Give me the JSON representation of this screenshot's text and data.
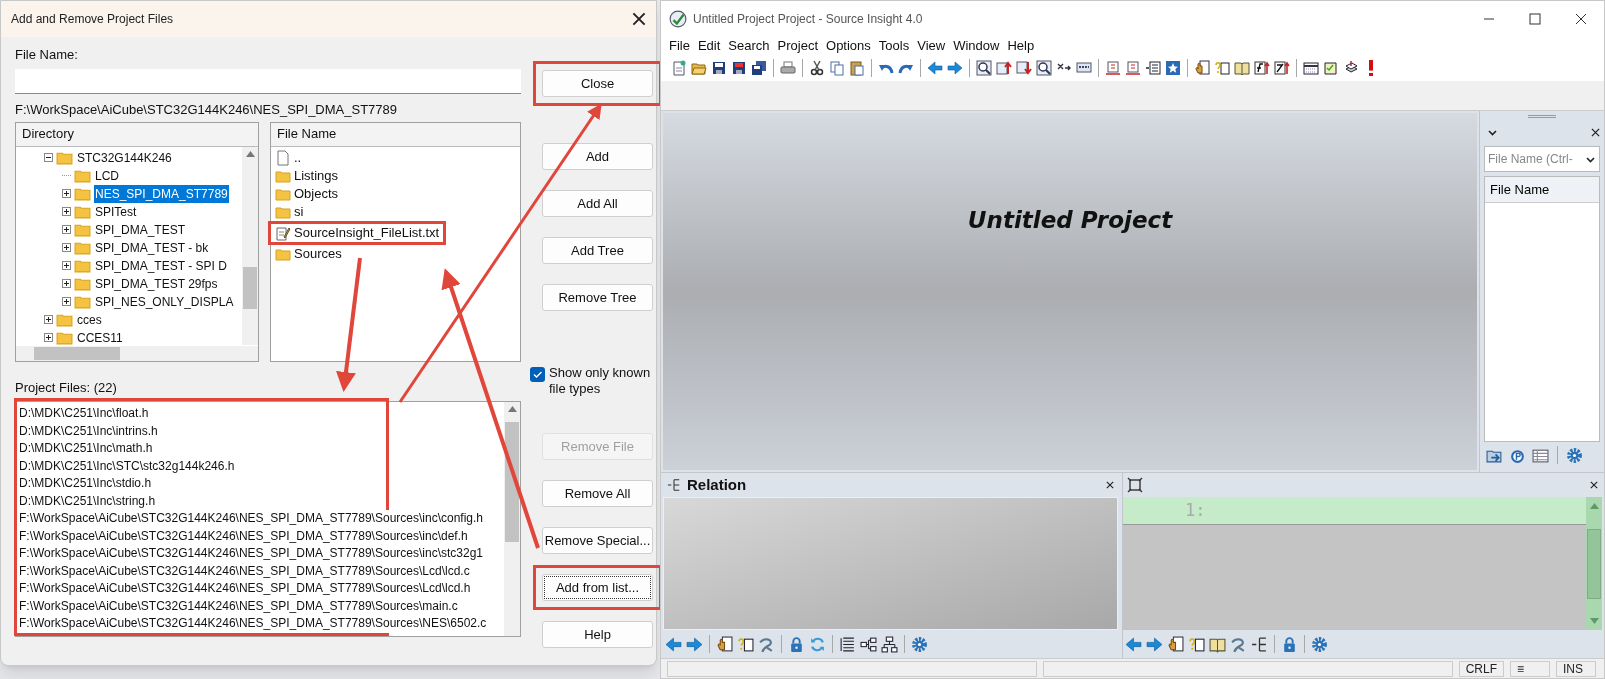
{
  "dialog": {
    "title": "Add and Remove Project Files",
    "file_name_label": "File Name:",
    "path": "F:\\WorkSpace\\AiCube\\STC32G144K246\\NES_SPI_DMA_ST7789",
    "directory": {
      "header": "Directory",
      "items": [
        {
          "label": "STC32G144K246",
          "expanded": true,
          "selected": false,
          "children": [
            {
              "label": "LCD",
              "selected": false
            },
            {
              "label": "NES_SPI_DMA_ST7789",
              "expanded": false,
              "selected": true
            },
            {
              "label": "SPITest",
              "expanded": false,
              "selected": false
            },
            {
              "label": "SPI_DMA_TEST",
              "expanded": false,
              "selected": false
            },
            {
              "label": "SPI_DMA_TEST - bk",
              "expanded": false,
              "selected": false
            },
            {
              "label": "SPI_DMA_TEST - SPI D",
              "expanded": false,
              "selected": false
            },
            {
              "label": "SPI_DMA_TEST 29fps",
              "expanded": false,
              "selected": false
            },
            {
              "label": "SPI_NES_ONLY_DISPLA",
              "expanded": false,
              "selected": false
            }
          ]
        },
        {
          "label": "cces",
          "expanded": false,
          "selected": false
        },
        {
          "label": "CCES11",
          "expanded": false,
          "selected": false
        }
      ]
    },
    "files": {
      "header": "File Name",
      "items": [
        {
          "label": "..",
          "kind": "page",
          "highlighted": false
        },
        {
          "label": "Listings",
          "kind": "folder",
          "highlighted": false
        },
        {
          "label": "Objects",
          "kind": "folder",
          "highlighted": false
        },
        {
          "label": "si",
          "kind": "folder",
          "highlighted": false
        },
        {
          "label": "SourceInsight_FileList.txt",
          "kind": "note",
          "highlighted": true
        },
        {
          "label": "Sources",
          "kind": "folder",
          "highlighted": false
        }
      ]
    },
    "top_buttons": [
      {
        "label": "Close",
        "disabled": false,
        "focused": false,
        "highlighted": true
      },
      {
        "label": "Add",
        "disabled": false,
        "focused": false,
        "highlighted": false
      },
      {
        "label": "Add All",
        "disabled": false,
        "focused": false,
        "highlighted": false
      },
      {
        "label": "Add Tree",
        "disabled": false,
        "focused": false,
        "highlighted": false
      },
      {
        "label": "Remove Tree",
        "disabled": false,
        "focused": false,
        "highlighted": false
      }
    ],
    "checkbox": {
      "label": "Show only known file types",
      "checked": true
    },
    "project_files_label": "Project Files: (22)",
    "project_files": [
      "D:\\MDK\\C251\\Inc\\float.h",
      "D:\\MDK\\C251\\Inc\\intrins.h",
      "D:\\MDK\\C251\\Inc\\math.h",
      "D:\\MDK\\C251\\Inc\\STC\\stc32g144k246.h",
      "D:\\MDK\\C251\\Inc\\stdio.h",
      "D:\\MDK\\C251\\Inc\\string.h",
      "F:\\WorkSpace\\AiCube\\STC32G144K246\\NES_SPI_DMA_ST7789\\Sources\\inc\\config.h",
      "F:\\WorkSpace\\AiCube\\STC32G144K246\\NES_SPI_DMA_ST7789\\Sources\\inc\\def.h",
      "F:\\WorkSpace\\AiCube\\STC32G144K246\\NES_SPI_DMA_ST7789\\Sources\\inc\\stc32g1",
      "F:\\WorkSpace\\AiCube\\STC32G144K246\\NES_SPI_DMA_ST7789\\Sources\\Lcd\\lcd.c",
      "F:\\WorkSpace\\AiCube\\STC32G144K246\\NES_SPI_DMA_ST7789\\Sources\\Lcd\\lcd.h",
      "F:\\WorkSpace\\AiCube\\STC32G144K246\\NES_SPI_DMA_ST7789\\Sources\\main.c",
      "F:\\WorkSpace\\AiCube\\STC32G144K246\\NES_SPI_DMA_ST7789\\Sources\\NES\\6502.c"
    ],
    "bottom_buttons": [
      {
        "label": "Remove File",
        "disabled": true,
        "focused": false,
        "highlighted": false
      },
      {
        "label": "Remove All",
        "disabled": false,
        "focused": false,
        "highlighted": false
      },
      {
        "label": "Remove Special...",
        "disabled": false,
        "focused": false,
        "highlighted": false
      },
      {
        "label": "Add from list...",
        "disabled": false,
        "focused": true,
        "highlighted": true
      },
      {
        "label": "Help",
        "disabled": false,
        "focused": false,
        "highlighted": false
      }
    ]
  },
  "editor": {
    "title": "Untitled Project Project - Source Insight 4.0",
    "menu": [
      "File",
      "Edit",
      "Search",
      "Project",
      "Options",
      "Tools",
      "View",
      "Window",
      "Help"
    ],
    "project_title": "Untitled Project",
    "file_panel": {
      "placeholder": "File Name (Ctrl-",
      "header": "File Name"
    },
    "relation_panel": {
      "title": "Relation"
    },
    "context_panel": {
      "line_number": "1:"
    },
    "status_bar": [
      "CRLF",
      "≡",
      "INS"
    ]
  }
}
